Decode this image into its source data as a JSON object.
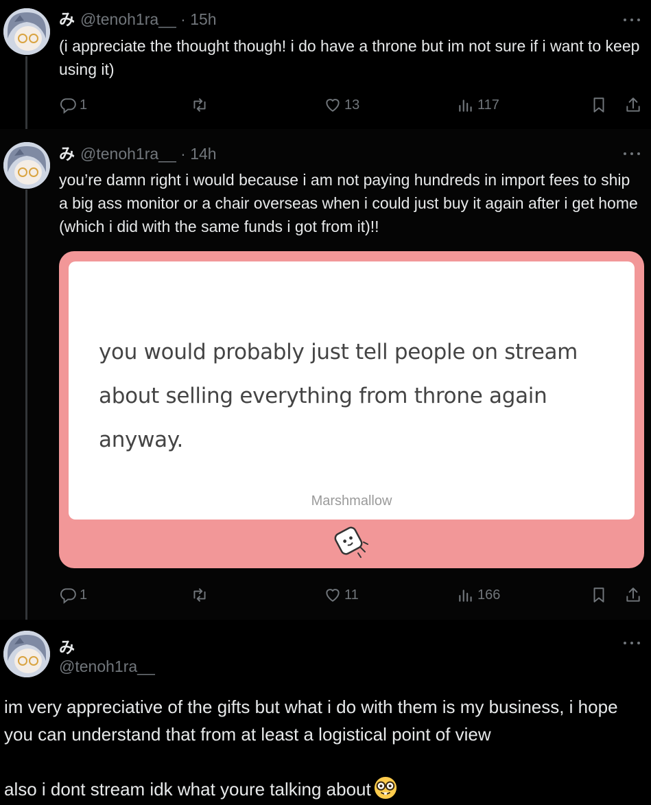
{
  "tweets": [
    {
      "author_name": "み",
      "handle": "@tenoh1ra__",
      "separator": "·",
      "time": "15h",
      "text": "(i appreciate the thought though! i do have a throne but im not sure if i want to keep using it)",
      "replies": "1",
      "likes": "13",
      "views": "117"
    },
    {
      "author_name": "み",
      "handle": "@tenoh1ra__",
      "separator": "·",
      "time": "14h",
      "text": "you’re damn right i would because i am not paying hundreds in import fees to ship a big ass monitor or a chair overseas when i could just buy it again after i get home (which i did with the same funds i got from it)!!",
      "media": {
        "question": "you would probably just tell people on stream about selling everything from throne again anyway.",
        "brand": "Marshmallow"
      },
      "replies": "1",
      "likes": "11",
      "views": "166"
    },
    {
      "author_name": "み",
      "handle": "@tenoh1ra__",
      "paragraph1": "im very appreciative of the gifts but what i do with them is my business, i hope you can understand that from at least a logistical point of view",
      "paragraph2": "also i dont stream idk what youre talking about",
      "emoji": "nerd-face-emoji"
    }
  ],
  "icons": [
    "more-icon",
    "reply-icon",
    "retweet-icon",
    "like-icon",
    "views-icon",
    "bookmark-icon",
    "share-icon",
    "marshmallow-icon"
  ],
  "colors": {
    "background": "#000000",
    "text": "#e7e9ea",
    "muted": "#71767b",
    "media_pink": "#f29798",
    "thread_line": "#333639"
  }
}
